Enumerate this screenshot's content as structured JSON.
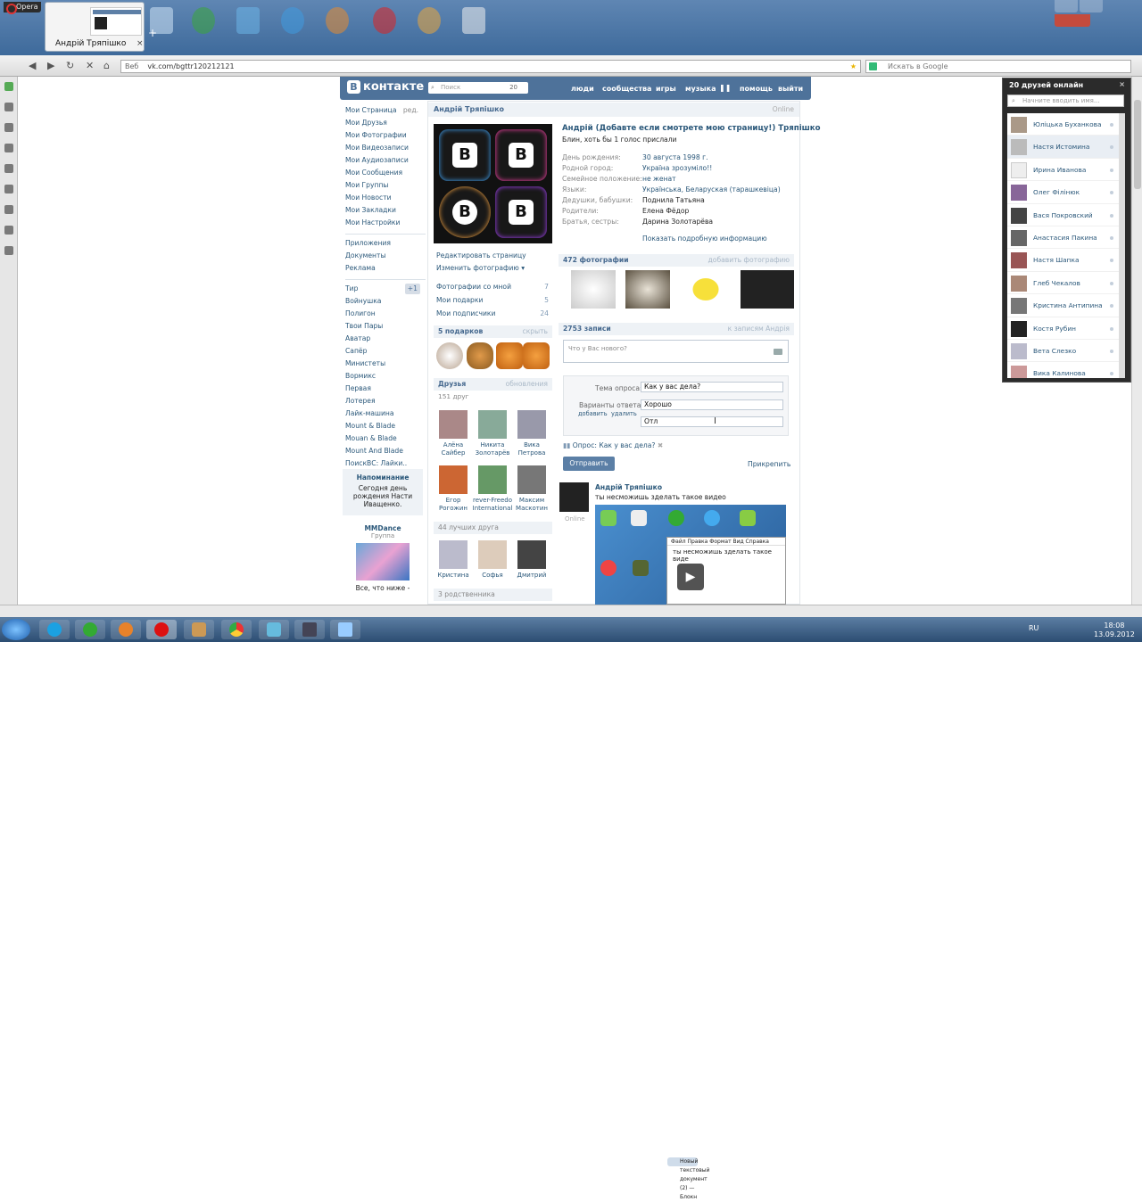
{
  "browser": {
    "app_name": "Opera",
    "tab_title": "Андрій Тряпішко",
    "tab_close": "×",
    "new_tab": "+",
    "address_prefix": "Веб",
    "url": "vk.com/bgttr120212121",
    "search_placeholder": "Искать в Google"
  },
  "header": {
    "logo_letter": "В",
    "logo_text": "контакте",
    "search_placeholder": "Поиск",
    "search_count": "20",
    "nav": [
      "люди",
      "сообщества",
      "игры",
      "музыка",
      "помощь",
      "выйти"
    ]
  },
  "sidebar": {
    "edit_label": "ред.",
    "main_items": [
      "Мои Страница",
      "Мои Друзья",
      "Мои Фотографии",
      "Мои Видеозаписи",
      "Мои Аудиозаписи",
      "Мои Сообщения",
      "Мои Группы",
      "Мои Новости",
      "Мои Закладки",
      "Мои Настройки"
    ],
    "section_items": [
      "Приложения",
      "Документы",
      "Реклама"
    ],
    "app_items": [
      "Тир",
      "Войнушка",
      "Полигон",
      "Твои Пары",
      "Аватар",
      "Сапёр",
      "Министеты",
      "Вормикс",
      "Первая",
      "Лотерея",
      "Лайк-машина",
      "Mount & Blade",
      "Mouan & Blade",
      "Mount And Blade",
      "ПоискВС: Лайки.."
    ],
    "tir_badge": "+1",
    "reminder_title": "Напоминание",
    "reminder_text": "Сегодня день рождения Насти Иващенко.",
    "group_name": "MMDance",
    "group_label": "Группа",
    "group_caption": "Все, что ниже -"
  },
  "profile": {
    "name_bar": "Андрій Тряпішко",
    "online": "Online",
    "full_name": "Андрій (Добавте если смотрете мою страницу!) Тряпішко",
    "status": "Блин, хоть бы 1 голос прислали",
    "info": [
      {
        "k": "День рождения:",
        "v": "30 августа 1998 г."
      },
      {
        "k": "Родной город:",
        "v": "Україна зрозуміло!!"
      },
      {
        "k": "Семейное положение:",
        "v": "не женат"
      },
      {
        "k": "Языки:",
        "v": "Українська, Беларуская (тарашкевіца)"
      },
      {
        "k": "Дедушки, бабушки:",
        "v": "Поднила Татьяна"
      },
      {
        "k": "Родители:",
        "v": "Елена Фёдор"
      },
      {
        "k": "Братья, сестры:",
        "v": "Дарина Золотарёва"
      }
    ],
    "more_info": "Показать подробную информацию",
    "avatar_letters": [
      "B",
      "B",
      "B",
      "B"
    ]
  },
  "profile_actions": {
    "edit": "Редактировать страницу",
    "change_photo": "Изменить фотографию",
    "dropdown_glyph": "▾",
    "photos_with_me": "Фотографии со мной",
    "photos_with_me_count": "7",
    "gifts": "Мои подарки",
    "gifts_count": "5",
    "subscribers": "Мои подписчики",
    "subscribers_count": "24"
  },
  "gifts_section": {
    "title": "5 подарков",
    "action": "скрыть"
  },
  "friends_section": {
    "title": "Друзья",
    "action": "обновления",
    "count": "151 друг",
    "friends": [
      {
        "name": "Алёна Сайбер"
      },
      {
        "name": "Никита Золотарёв"
      },
      {
        "name": "Вика Петрова"
      },
      {
        "name": "Егор Рогожин"
      },
      {
        "name": "rever-Freedo International"
      },
      {
        "name": "Максим Маскотин"
      }
    ],
    "best_count": "44 лучших друга",
    "best": [
      {
        "name": "Кристина"
      },
      {
        "name": "Софья"
      },
      {
        "name": "Дмитрий"
      }
    ],
    "relatives": "3 родственника"
  },
  "photos_section": {
    "title": "472 фотографии",
    "action": "добавить фотографию"
  },
  "wall": {
    "title": "2753 записи",
    "action": "к записям Андрія",
    "placeholder": "Что у Вас нового?",
    "poll_topic_label": "Тема опроса:",
    "poll_topic": "Как у вас дела?",
    "answers_label": "Варианты ответа:",
    "add": "добавить",
    "remove": "удалить",
    "answer1": "Хорошо",
    "answer2": "Отл",
    "poll_line": "Опрос: Как у вас дела?",
    "remove_glyph": "✖",
    "send": "Отправить",
    "attach": "Прикрепить"
  },
  "post": {
    "author": "Андрій Тряпішко",
    "text": "ты несможишь зделать такое видео",
    "online": "Online",
    "video_window_title": "Новый текстовый документ (2) — Блокн",
    "video_menu": "Файл  Правка  Формат  Вид  Справка",
    "video_text": "ты несможишь зделать такое виде",
    "play_glyph": "▶"
  },
  "friends_online": {
    "title": "20 друзей онлайн",
    "close": "×",
    "search_placeholder": "Начните вводить имя...",
    "list": [
      "Юлiцька Буханкова",
      "Настя Истомина",
      "Ирина Иванова",
      "Олег Філінюк",
      "Вася Покровский",
      "Анастасия Пакина",
      "Настя Шапка",
      "Глеб Чекалов",
      "Кристина Антипина",
      "Костя Рубин",
      "Вета Слезко",
      "Вика Калинова"
    ]
  },
  "taskbar": {
    "lang": "RU",
    "time": "18:08",
    "date": "13.09.2012"
  }
}
